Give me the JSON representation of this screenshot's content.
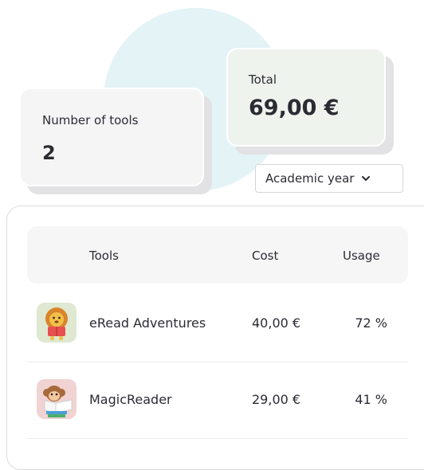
{
  "summary": {
    "tools_count_label": "Number of tools",
    "tools_count_value": "2",
    "total_label": "Total",
    "total_value": "69,00 €"
  },
  "filter": {
    "selected": "Academic year"
  },
  "table": {
    "headers": {
      "tools": "Tools",
      "cost": "Cost",
      "usage": "Usage"
    },
    "rows": [
      {
        "name": "eRead Adventures",
        "cost": "40,00 €",
        "usage": "72 %",
        "icon": "lion-reading-icon"
      },
      {
        "name": "MagicReader",
        "cost": "29,00 €",
        "usage": "41 %",
        "icon": "monkey-reading-icon"
      }
    ]
  },
  "colors": {
    "blob": "#e3f3f6",
    "total_card": "#eef3ee",
    "count_card": "#f5f5f6"
  }
}
